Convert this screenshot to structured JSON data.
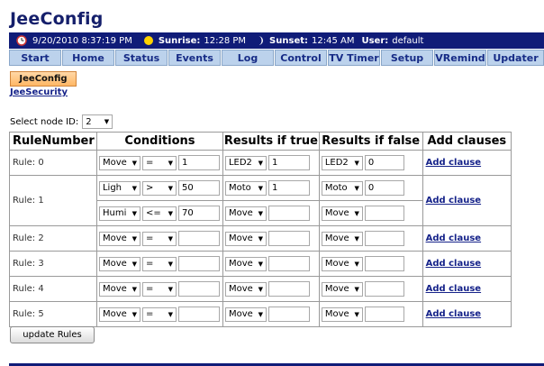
{
  "app": {
    "title": "JeeConfig"
  },
  "statusbar": {
    "datetime": "9/20/2010 8:37:19 PM",
    "sunrise_label": "Sunrise:",
    "sunrise_value": "12:28 PM",
    "sunset_label": "Sunset:",
    "sunset_value": "12:45 AM",
    "user_label": "User:",
    "user_value": "default",
    "colors": {
      "bar": "#101c78",
      "sun": "#ffd200"
    }
  },
  "nav": [
    {
      "label": "Start"
    },
    {
      "label": "Home"
    },
    {
      "label": "Status"
    },
    {
      "label": "Events"
    },
    {
      "label": "Log"
    },
    {
      "label": "Control"
    },
    {
      "label": "TV Timer"
    },
    {
      "label": "Setup"
    },
    {
      "label": "VRemind"
    },
    {
      "label": "Updater"
    }
  ],
  "subnav": {
    "active_tab": "JeeConfig",
    "link": "JeeSecurity"
  },
  "node_select": {
    "label": "Select node ID:",
    "value": "2"
  },
  "table": {
    "headers": [
      "RuleNumber",
      "Conditions",
      "Results if true",
      "Results if false",
      "Add clauses"
    ],
    "add_clause_label": "Add clause",
    "rules": [
      {
        "name": "Rule: 0",
        "conditions": [
          {
            "sensor": "Move",
            "op": "=",
            "value": "1"
          }
        ],
        "true_dev": "LED2",
        "true_val": "1",
        "false_dev": "LED2",
        "false_val": "0"
      },
      {
        "name": "Rule: 1",
        "conditions": [
          {
            "sensor": "Ligh",
            "op": ">",
            "value": "50"
          },
          {
            "sensor": "Humi",
            "op": "<=",
            "value": "70"
          }
        ],
        "true_dev": "Moto",
        "true_val": "1",
        "false_dev": "Moto",
        "false_val": "0",
        "true_dev_2": "Move",
        "true_val_2": "",
        "false_dev_2": "Move",
        "false_val_2": ""
      },
      {
        "name": "Rule: 2",
        "conditions": [
          {
            "sensor": "Move",
            "op": "=",
            "value": ""
          }
        ],
        "true_dev": "Move",
        "true_val": "",
        "false_dev": "Move",
        "false_val": ""
      },
      {
        "name": "Rule: 3",
        "conditions": [
          {
            "sensor": "Move",
            "op": "=",
            "value": ""
          }
        ],
        "true_dev": "Move",
        "true_val": "",
        "false_dev": "Move",
        "false_val": ""
      },
      {
        "name": "Rule: 4",
        "conditions": [
          {
            "sensor": "Move",
            "op": "=",
            "value": ""
          }
        ],
        "true_dev": "Move",
        "true_val": "",
        "false_dev": "Move",
        "false_val": ""
      },
      {
        "name": "Rule: 5",
        "conditions": [
          {
            "sensor": "Move",
            "op": "=",
            "value": ""
          }
        ],
        "true_dev": "Move",
        "true_val": "",
        "false_dev": "Move",
        "false_val": ""
      }
    ]
  },
  "update_button": "update Rules"
}
